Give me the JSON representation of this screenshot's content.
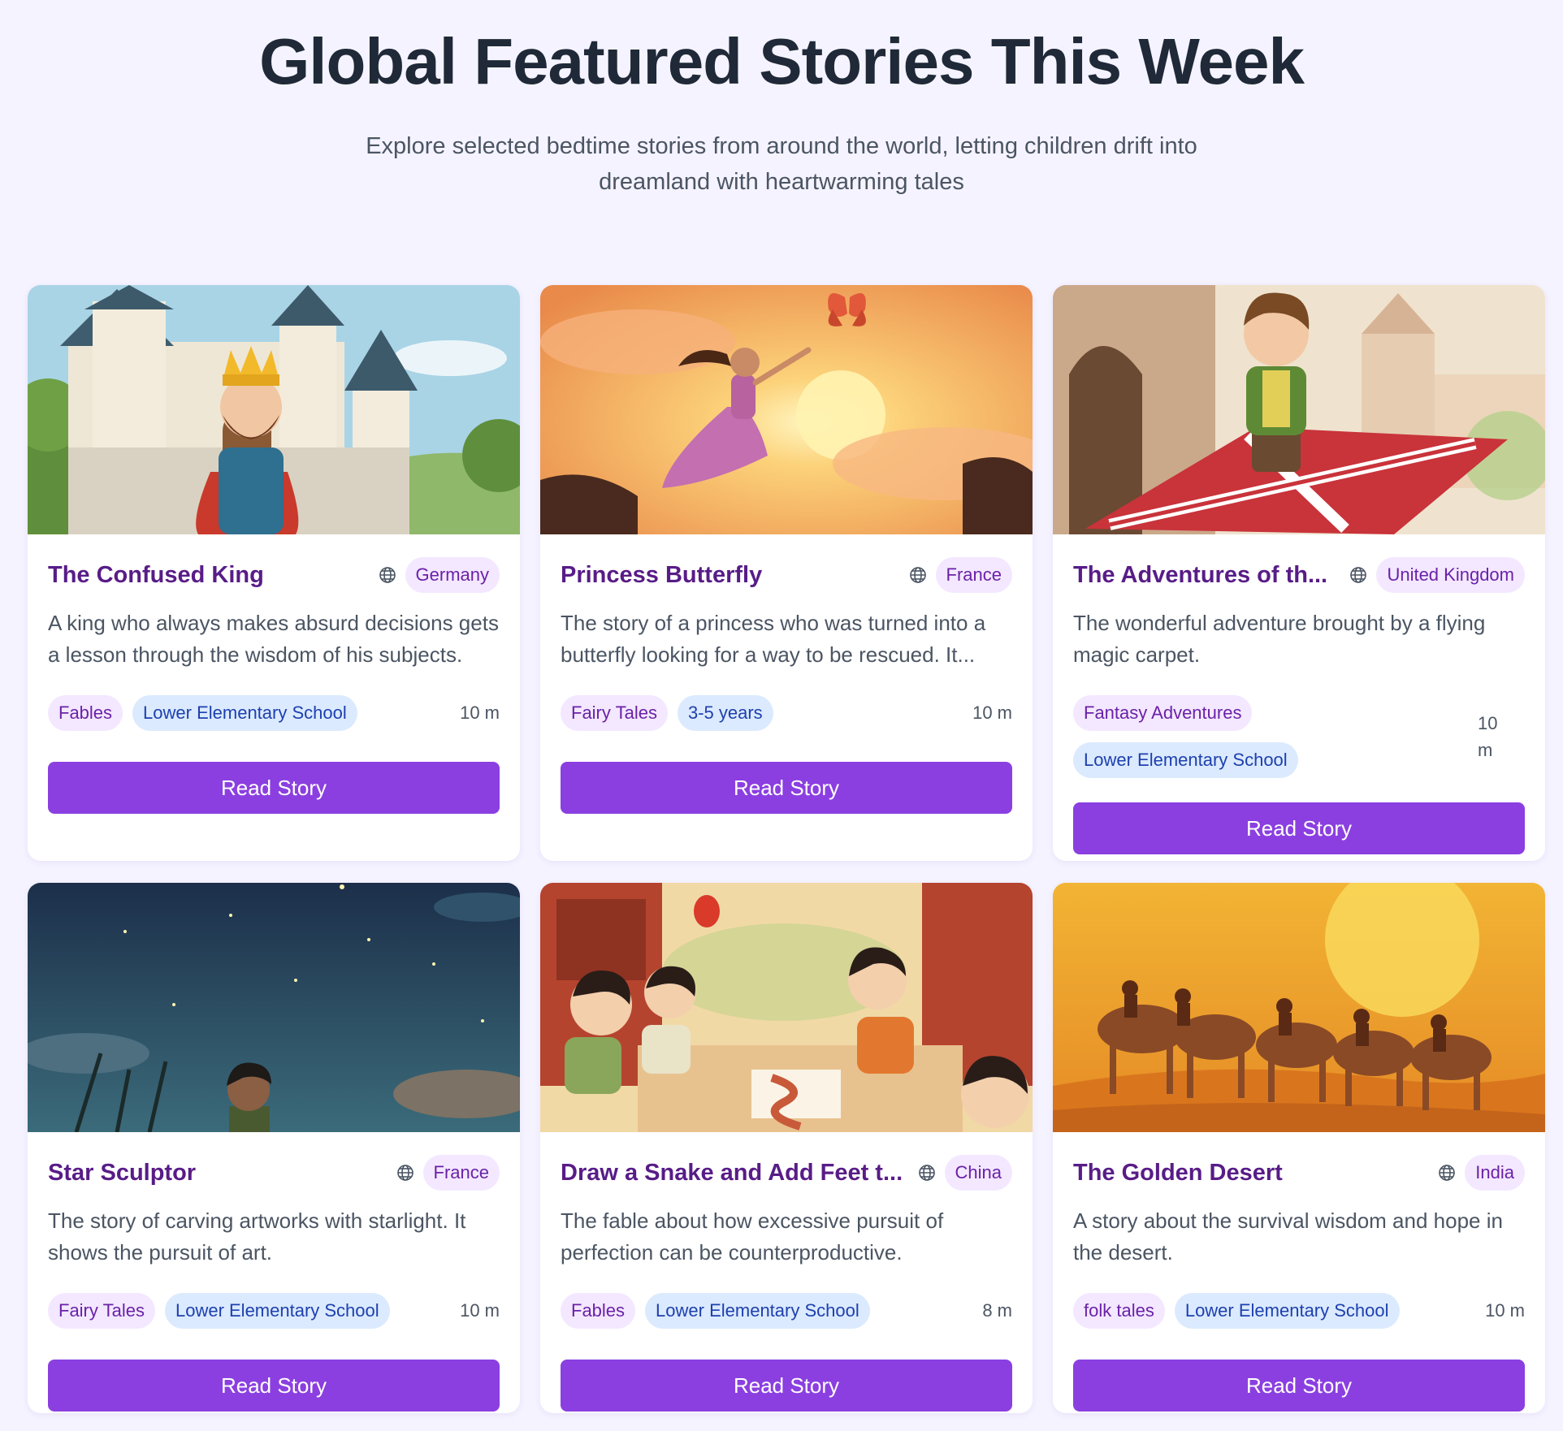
{
  "header": {
    "title": "Global Featured Stories This Week",
    "subtitle": "Explore selected bedtime stories from around the world, letting children drift into dreamland with heartwarming tales"
  },
  "colors": {
    "background": "#f5f3ff",
    "title": "#581c87",
    "button": "#8b3fe0",
    "category_tag_bg": "#f3e8ff",
    "level_tag_bg": "#dbeafe"
  },
  "stories": [
    {
      "title": "The Confused King",
      "country": "Germany",
      "description": "A king who always makes absurd decisions gets a lesson through the wisdom of his subjects.",
      "category": "Fables",
      "level": "Lower Elementary School",
      "duration": "10 m",
      "button_label": "Read Story"
    },
    {
      "title": "Princess Butterfly",
      "country": "France",
      "description": "The story of a princess who was turned into a butterfly looking for a way to be rescued. It...",
      "category": "Fairy Tales",
      "level": "3-5 years",
      "duration": "10 m",
      "button_label": "Read Story"
    },
    {
      "title": "The Adventures of th...",
      "country": "United Kingdom",
      "description": "The wonderful adventure brought by a flying magic carpet.",
      "category": "Fantasy Adventures",
      "level": "Lower Elementary School",
      "duration": "10 m",
      "button_label": "Read Story"
    },
    {
      "title": "Star Sculptor",
      "country": "France",
      "description": "The story of carving artworks with starlight. It shows the pursuit of art.",
      "category": "Fairy Tales",
      "level": "Lower Elementary School",
      "duration": "10 m",
      "button_label": "Read Story"
    },
    {
      "title": "Draw a Snake and Add Feet t...",
      "country": "China",
      "description": "The fable about how excessive pursuit of perfection can be counterproductive.",
      "category": "Fables",
      "level": "Lower Elementary School",
      "duration": "8 m",
      "button_label": "Read Story"
    },
    {
      "title": "The Golden Desert",
      "country": "India",
      "description": "A story about the survival wisdom and hope in the desert.",
      "category": "folk tales",
      "level": "Lower Elementary School",
      "duration": "10 m",
      "button_label": "Read Story"
    }
  ]
}
